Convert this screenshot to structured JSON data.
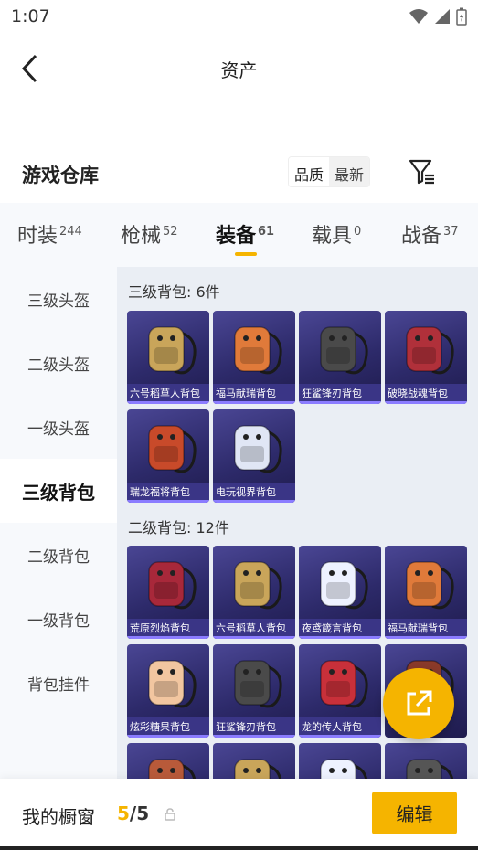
{
  "status_bar": {
    "time": "1:07"
  },
  "header": {
    "title": "资产"
  },
  "warehouse": {
    "title": "游戏仓库",
    "sort_options": [
      "品质",
      "最新"
    ]
  },
  "tabs": [
    {
      "label": "时装",
      "count": "244"
    },
    {
      "label": "枪械",
      "count": "52"
    },
    {
      "label": "装备",
      "count": "61",
      "active": true
    },
    {
      "label": "载具",
      "count": "0"
    },
    {
      "label": "战备",
      "count": "37"
    }
  ],
  "sidebar": [
    {
      "label": "三级头盔"
    },
    {
      "label": "二级头盔"
    },
    {
      "label": "一级头盔"
    },
    {
      "label": "三级背包",
      "active": true
    },
    {
      "label": "二级背包"
    },
    {
      "label": "一级背包"
    },
    {
      "label": "背包挂件"
    }
  ],
  "sections": [
    {
      "label": "三级背包: 6件",
      "items": [
        {
          "name": "六号稻草人背包",
          "icon": "scarecrow-backpack-icon",
          "color": "#c9a55a"
        },
        {
          "name": "福马献瑞背包",
          "icon": "horse-backpack-icon",
          "color": "#e07a3a"
        },
        {
          "name": "狂鲨锋刃背包",
          "icon": "shark-backpack-icon",
          "color": "#4a4a4a"
        },
        {
          "name": "破晓战魂背包",
          "icon": "warrior-backpack-icon",
          "color": "#b0303a"
        },
        {
          "name": "瑞龙福将背包",
          "icon": "dragon-backpack-icon",
          "color": "#c84a2a"
        },
        {
          "name": "电玩视界背包",
          "icon": "gamer-backpack-icon",
          "color": "#e0e6f5"
        }
      ]
    },
    {
      "label": "二级背包: 12件",
      "items": [
        {
          "name": "荒原烈焰背包",
          "icon": "flame-backpack-icon",
          "color": "#a8283a"
        },
        {
          "name": "六号稻草人背包",
          "icon": "scarecrow-backpack-icon",
          "color": "#c9a55a"
        },
        {
          "name": "夜鸢箴言背包",
          "icon": "kite-backpack-icon",
          "color": "#eef2ff"
        },
        {
          "name": "福马献瑞背包",
          "icon": "horse-backpack-icon",
          "color": "#e07a3a"
        },
        {
          "name": "炫彩糖果背包",
          "icon": "candy-backpack-icon",
          "color": "#f2c6a0"
        },
        {
          "name": "狂鲨锋刃背包",
          "icon": "shark-backpack-icon",
          "color": "#4a4a4a"
        },
        {
          "name": "龙的传人背包",
          "icon": "dragon-heir-backpack-icon",
          "color": "#c8303a"
        },
        {
          "name": "",
          "icon": "backpack-icon",
          "color": "#8a3a2a"
        },
        {
          "name": "",
          "icon": "backpack-icon",
          "color": "#b85a3a"
        },
        {
          "name": "",
          "icon": "backpack-icon",
          "color": "#c9a55a"
        },
        {
          "name": "",
          "icon": "backpack-icon",
          "color": "#eef2ff"
        },
        {
          "name": "",
          "icon": "backpack-icon",
          "color": "#555555"
        }
      ]
    }
  ],
  "showcase": {
    "label": "我的橱窗",
    "current": "5",
    "total": "/5",
    "edit_label": "编辑"
  },
  "colors": {
    "accent": "#f5b400",
    "card_bg": "#3a3586"
  }
}
